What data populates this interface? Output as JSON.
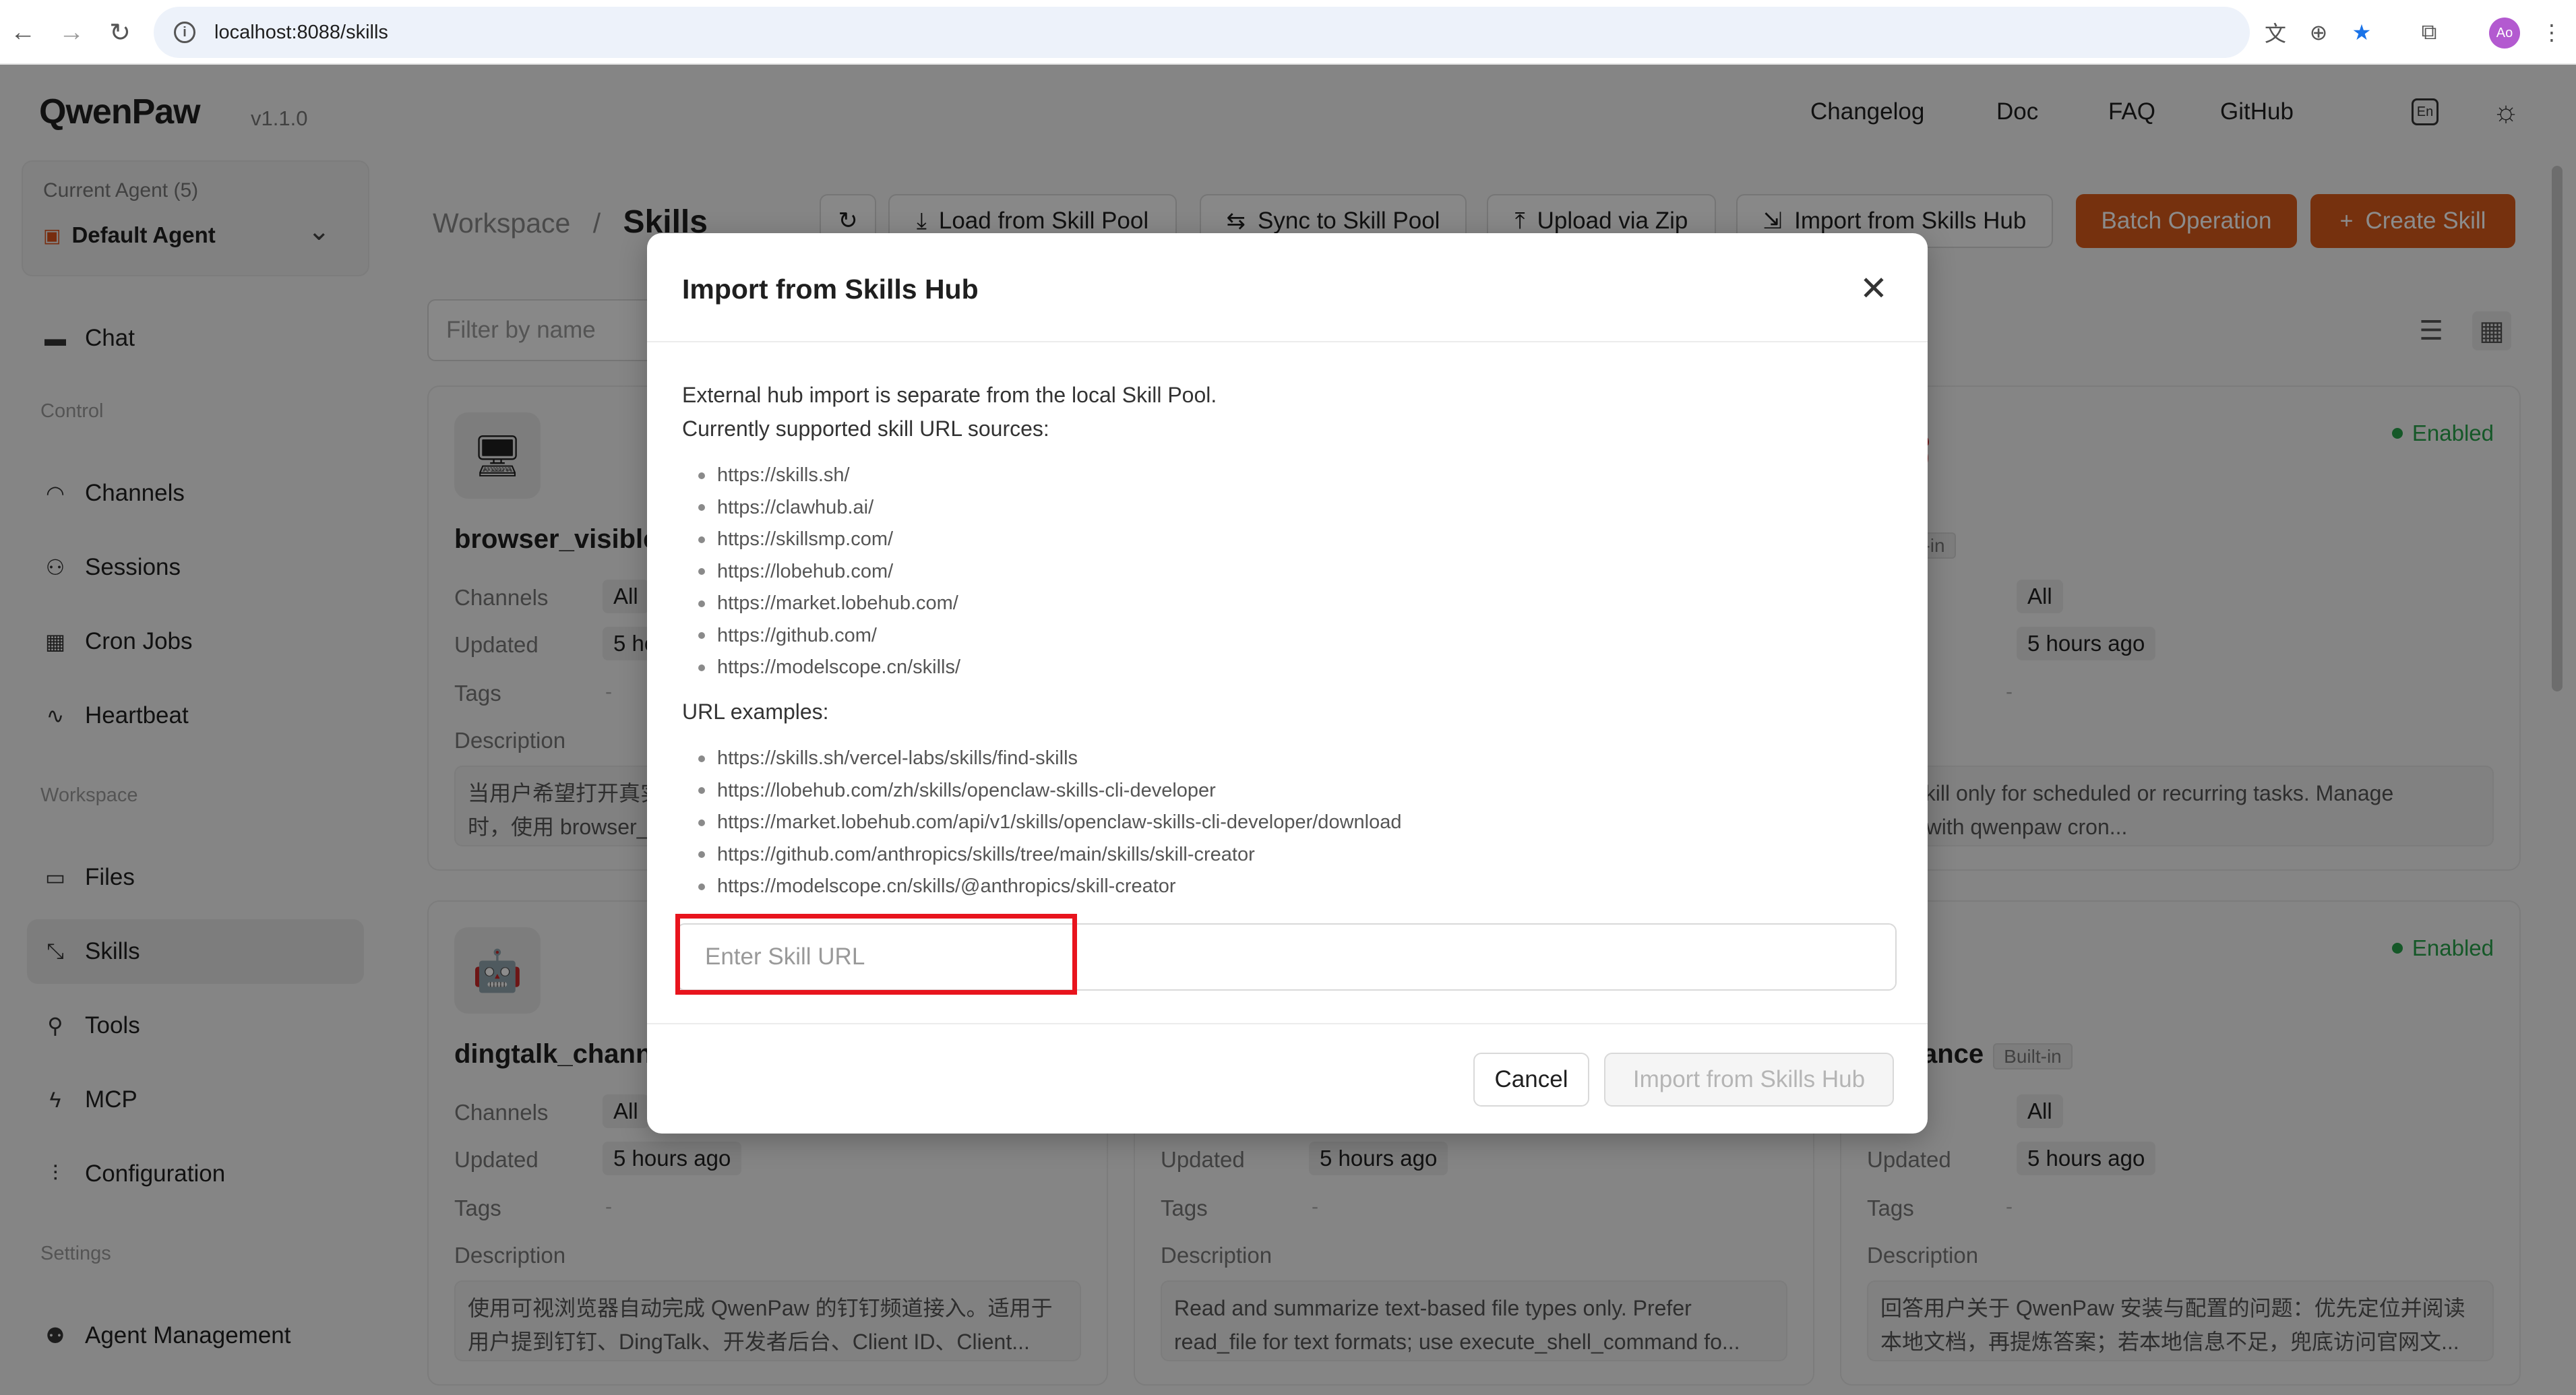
{
  "browser": {
    "url": "localhost:8088/skills",
    "avatar_initials": "Ao"
  },
  "app": {
    "logo": "QwenPaw",
    "version": "v1.1.0",
    "nav_links": [
      "Changelog",
      "Doc",
      "FAQ",
      "GitHub"
    ],
    "lang_icon": "En"
  },
  "sidebar": {
    "agent_label": "Current Agent (5)",
    "agent_name": "Default Agent",
    "chat": "Chat",
    "control_label": "Control",
    "control_items": [
      "Channels",
      "Sessions",
      "Cron Jobs",
      "Heartbeat"
    ],
    "workspace_label": "Workspace",
    "workspace_items": [
      "Files",
      "Skills",
      "Tools",
      "MCP",
      "Configuration"
    ],
    "settings_label": "Settings",
    "settings_items": [
      "Agent Management"
    ]
  },
  "main": {
    "breadcrumb_parent": "Workspace",
    "breadcrumb_sep": "/",
    "breadcrumb_current": "Skills",
    "buttons": {
      "load": "Load from Skill Pool",
      "sync": "Sync to Skill Pool",
      "upload": "Upload via Zip",
      "import": "Import from Skills Hub",
      "batch": "Batch Operation",
      "create": "Create Skill"
    },
    "filter_placeholder": "Filter by name",
    "field_labels": {
      "channels": "Channels",
      "updated": "Updated",
      "tags": "Tags",
      "description": "Description"
    },
    "cards": [
      {
        "title": "browser_visible",
        "channels": "All",
        "updated": "5 ho",
        "tags": "-",
        "desc": "当用户希望打开真实\n时，使用 browser_"
      },
      {
        "title": "",
        "enabled": "Enabled",
        "badge": "Built-in",
        "channels_lbl": "nels",
        "channels": "All",
        "updated_lbl": "ted",
        "updated": "5 hours ago",
        "tags": "-",
        "desc_lbl": "iption",
        "desc": "his skill only for scheduled or recurring tasks. Manage\njobs with qwenpaw cron..."
      },
      {
        "title": "dingtalk_channe",
        "channels": "All",
        "updated": "5 hours ago",
        "tags": "-",
        "desc": "使用可视浏览器自动完成 QwenPaw 的钉钉频道接入。适用于\n用户提到钉钉、DingTalk、开发者后台、Client ID、Client..."
      },
      {
        "title": "",
        "channels": "",
        "updated": "5 hours ago",
        "tags": "-",
        "desc": "Read and summarize text-based file types only. Prefer\nread_file for text formats; use execute_shell_command fo..."
      },
      {
        "title": "ance",
        "enabled": "Enabled",
        "badge": "Built-in",
        "channels_lbl": "nels",
        "channels": "All",
        "updated": "5 hours ago",
        "tags": "-",
        "desc": "回答用户关于 QwenPaw 安装与配置的问题：优先定位并阅读\n本地文档，再提炼答案；若本地信息不足，兜底访问官网文..."
      }
    ]
  },
  "modal": {
    "title": "Import from Skills Hub",
    "intro_line1": "External hub import is separate from the local Skill Pool.",
    "intro_line2": "Currently supported skill URL sources:",
    "sources": [
      "https://skills.sh/",
      "https://clawhub.ai/",
      "https://skillsmp.com/",
      "https://lobehub.com/",
      "https://market.lobehub.com/",
      "https://github.com/",
      "https://modelscope.cn/skills/"
    ],
    "examples_label": "URL examples:",
    "examples": [
      "https://skills.sh/vercel-labs/skills/find-skills",
      "https://lobehub.com/zh/skills/openclaw-skills-cli-developer",
      "https://market.lobehub.com/api/v1/skills/openclaw-skills-cli-developer/download",
      "https://github.com/anthropics/skills/tree/main/skills/skill-creator",
      "https://modelscope.cn/skills/@anthropics/skill-creator"
    ],
    "input_placeholder": "Enter Skill URL",
    "cancel": "Cancel",
    "submit": "Import from Skills Hub"
  },
  "colors": {
    "accent": "#d75a1b",
    "enabled": "#27a04a",
    "highlight": "#e8141d"
  }
}
